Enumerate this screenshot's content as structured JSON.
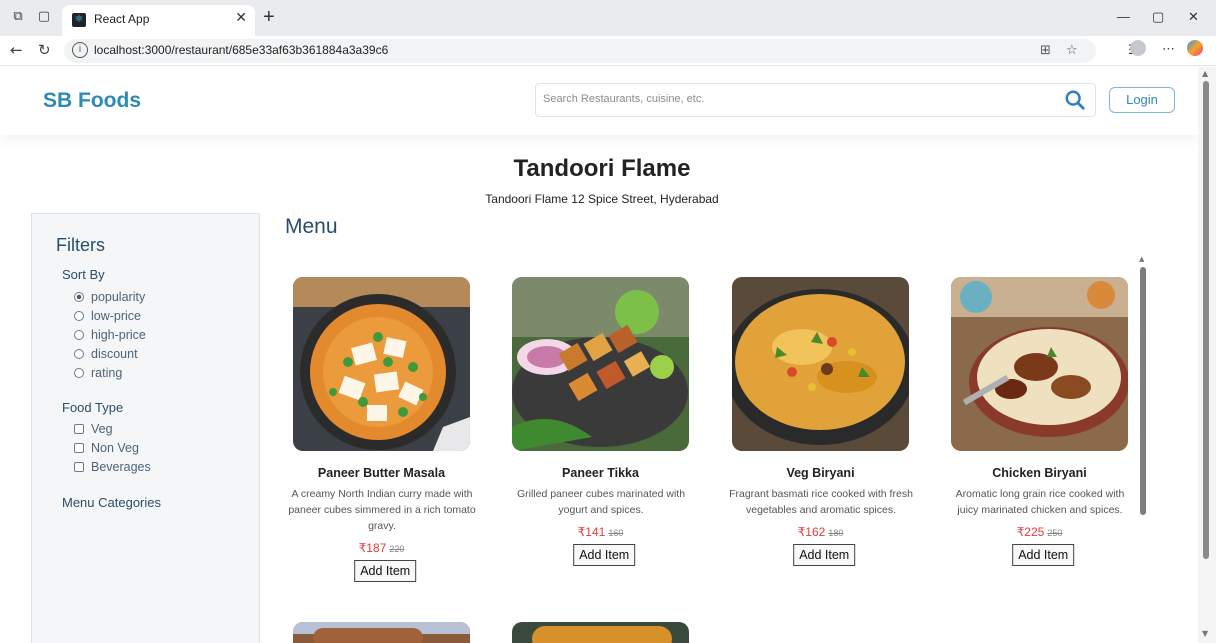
{
  "browser": {
    "tab_title": "React App",
    "url": "localhost:3000/restaurant/685e33af63b361884a3a39c6"
  },
  "header": {
    "logo": "SB Foods",
    "search_placeholder": "Search Restaurants, cuisine, etc.",
    "login_label": "Login"
  },
  "restaurant": {
    "name": "Tandoori Flame",
    "address": "Tandoori Flame 12 Spice Street, Hyderabad"
  },
  "filters": {
    "title": "Filters",
    "sort_by_label": "Sort By",
    "sort_options": [
      "popularity",
      "low-price",
      "high-price",
      "discount",
      "rating"
    ],
    "sort_selected": "popularity",
    "food_type_label": "Food Type",
    "food_types": [
      "Veg",
      "Non Veg",
      "Beverages"
    ],
    "menu_categories_label": "Menu Categories"
  },
  "menu": {
    "title": "Menu",
    "currency": "₹",
    "add_label": "Add Item",
    "items": [
      {
        "name": "Paneer Butter Masala",
        "description": "A creamy North Indian curry made with paneer cubes simmered in a rich tomato gravy.",
        "price": "₹187",
        "old_price": "220"
      },
      {
        "name": "Paneer Tikka",
        "description": "Grilled paneer cubes marinated with yogurt and spices.",
        "price": "₹141",
        "old_price": "160"
      },
      {
        "name": "Veg Biryani",
        "description": "Fragrant basmati rice cooked with fresh vegetables and aromatic spices.",
        "price": "₹162",
        "old_price": "180"
      },
      {
        "name": "Chicken Biryani",
        "description": "Aromatic long grain rice cooked with juicy marinated chicken and spices.",
        "price": "₹225",
        "old_price": "250"
      }
    ]
  },
  "colors": {
    "brand": "#2e8bb6",
    "price": "#e23b3b",
    "filter_heading": "#2b4d69"
  }
}
